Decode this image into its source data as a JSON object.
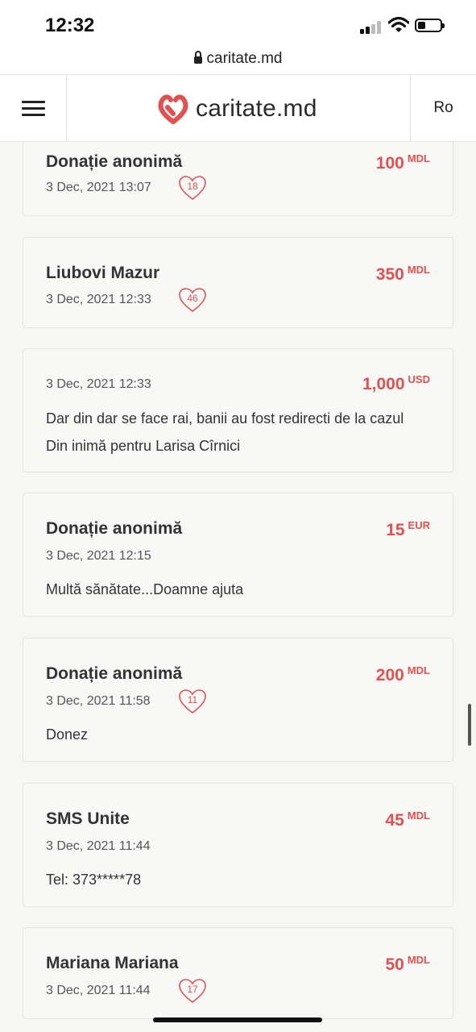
{
  "status_bar": {
    "time": "12:32"
  },
  "browser": {
    "url": "caritate.md"
  },
  "header": {
    "logo_text": "caritate.md",
    "language": "Ro"
  },
  "donations": [
    {
      "name": "Donație anonimă",
      "date": "3 Dec, 2021 13:07",
      "amount": "100",
      "currency": "MDL",
      "heart_count": "18",
      "message": ""
    },
    {
      "name": "Liubovi Mazur",
      "date": "3 Dec, 2021 12:33",
      "amount": "350",
      "currency": "MDL",
      "heart_count": "46",
      "message": ""
    },
    {
      "name": "",
      "date": "3 Dec, 2021 12:33",
      "amount": "1,000",
      "currency": "USD",
      "heart_count": "",
      "message": "Dar din dar se face rai, banii au fost redirecti de la cazul Din inimă pentru Larisa Cîrnici"
    },
    {
      "name": "Donație anonimă",
      "date": "3 Dec, 2021 12:15",
      "amount": "15",
      "currency": "EUR",
      "heart_count": "",
      "message": "Multă sănătate...Doamne ajuta"
    },
    {
      "name": "Donație anonimă",
      "date": "3 Dec, 2021 11:58",
      "amount": "200",
      "currency": "MDL",
      "heart_count": "11",
      "message": "Donez"
    },
    {
      "name": "SMS Unite",
      "date": "3 Dec, 2021 11:44",
      "amount": "45",
      "currency": "MDL",
      "heart_count": "",
      "message": "Tel: 373*****78"
    },
    {
      "name": "Mariana Mariana",
      "date": "3 Dec, 2021 11:44",
      "amount": "50",
      "currency": "MDL",
      "heart_count": "17",
      "message": ""
    }
  ],
  "colors": {
    "accent": "#e0514f",
    "background": "#f6f6f4",
    "text": "#333333"
  }
}
